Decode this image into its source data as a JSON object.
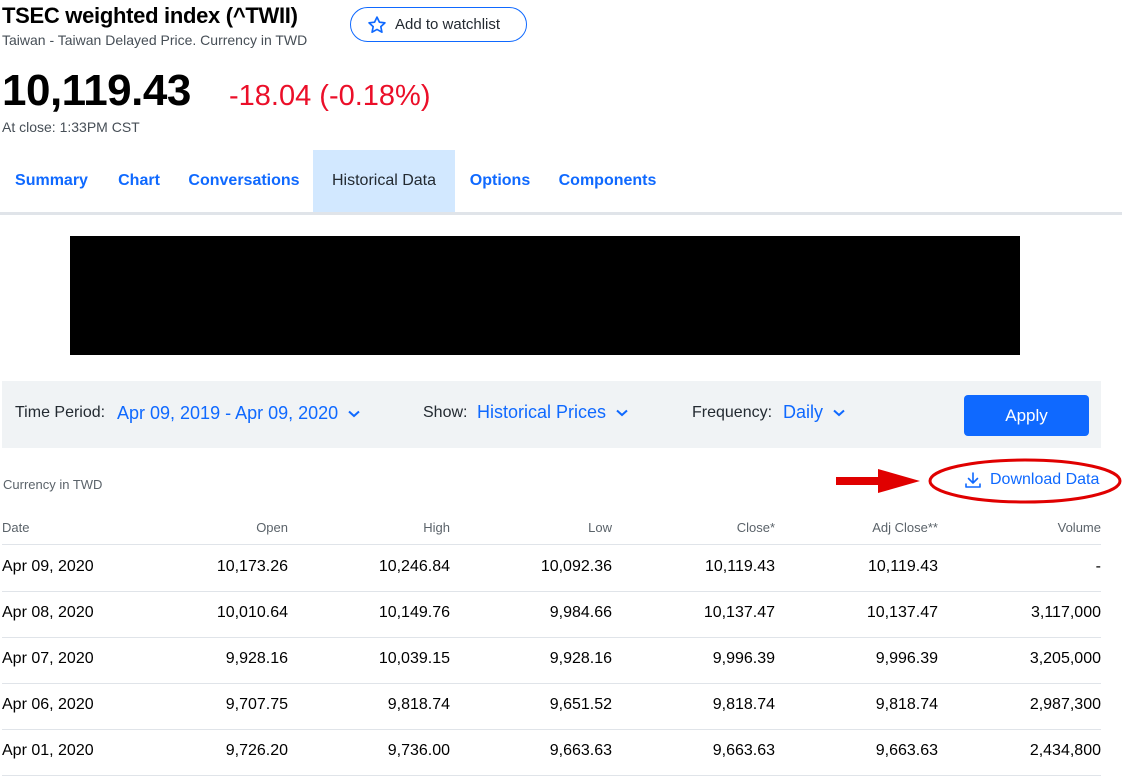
{
  "header": {
    "title": "TSEC weighted index (^TWII)",
    "subtitle": "Taiwan - Taiwan Delayed Price. Currency in TWD",
    "watchlist_label": "Add to watchlist"
  },
  "quote": {
    "price": "10,119.43",
    "change": "-18.04 (-0.18%)",
    "close_time": "At close: 1:33PM CST"
  },
  "tabs": [
    {
      "label": "Summary"
    },
    {
      "label": "Chart"
    },
    {
      "label": "Conversations"
    },
    {
      "label": "Historical Data"
    },
    {
      "label": "Options"
    },
    {
      "label": "Components"
    }
  ],
  "filters": {
    "time_period_label": "Time Period:",
    "time_period_value": "Apr 09, 2019 - Apr 09, 2020",
    "show_label": "Show:",
    "show_value": "Historical Prices",
    "frequency_label": "Frequency:",
    "frequency_value": "Daily",
    "apply_label": "Apply"
  },
  "currency_note": "Currency in TWD",
  "download_label": "Download Data",
  "table": {
    "columns": [
      "Date",
      "Open",
      "High",
      "Low",
      "Close*",
      "Adj Close**",
      "Volume"
    ],
    "rows": [
      [
        "Apr 09, 2020",
        "10,173.26",
        "10,246.84",
        "10,092.36",
        "10,119.43",
        "10,119.43",
        "-"
      ],
      [
        "Apr 08, 2020",
        "10,010.64",
        "10,149.76",
        "9,984.66",
        "10,137.47",
        "10,137.47",
        "3,117,000"
      ],
      [
        "Apr 07, 2020",
        "9,928.16",
        "10,039.15",
        "9,928.16",
        "9,996.39",
        "9,996.39",
        "3,205,000"
      ],
      [
        "Apr 06, 2020",
        "9,707.75",
        "9,818.74",
        "9,651.52",
        "9,818.74",
        "9,818.74",
        "2,987,300"
      ],
      [
        "Apr 01, 2020",
        "9,726.20",
        "9,736.00",
        "9,663.63",
        "9,663.63",
        "9,663.63",
        "2,434,800"
      ]
    ]
  },
  "colors": {
    "accent": "#0f69ff",
    "negative": "#eb0f29",
    "annotation": "#e00000",
    "active_tab_bg": "#d2e8ff",
    "filter_bg": "#f0f3f5"
  }
}
